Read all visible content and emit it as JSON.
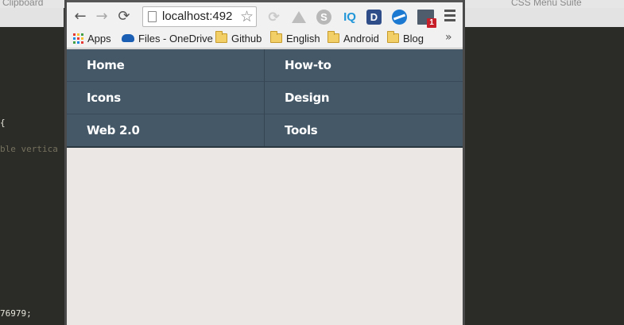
{
  "background": {
    "left_window_title": "Clipboard",
    "right_window_title": "CSS Menu Suite",
    "code_lines": [
      {
        "text": "{",
        "kind": "code"
      },
      {
        "text": "ble vertica",
        "kind": "comment"
      },
      {
        "text": "76979;",
        "kind": "code"
      }
    ]
  },
  "browser": {
    "nav": {
      "back": "←",
      "forward": "→",
      "reload": "⟳"
    },
    "url": "localhost:492",
    "star": "☆",
    "extensions": {
      "skype": "S",
      "iq": "IQ",
      "d": "D",
      "badge_count": "1"
    },
    "bookmarks": [
      {
        "label": "Apps",
        "icon": "apps-grid-icon"
      },
      {
        "label": "Files - OneDrive",
        "icon": "onedrive-cloud-icon"
      },
      {
        "label": "Github",
        "icon": "folder-icon"
      },
      {
        "label": "English",
        "icon": "folder-icon"
      },
      {
        "label": "Android",
        "icon": "folder-icon"
      },
      {
        "label": "Blog",
        "icon": "folder-icon"
      }
    ],
    "bookmarks_overflow": "»"
  },
  "menu": {
    "items": [
      {
        "label": "Home"
      },
      {
        "label": "How-to"
      },
      {
        "label": "Icons"
      },
      {
        "label": "Design"
      },
      {
        "label": "Web 2.0"
      },
      {
        "label": "Tools"
      }
    ]
  },
  "colors": {
    "menu_background": "#445868",
    "page_background": "#ebe7e4",
    "editor_background": "#2b2b27"
  }
}
